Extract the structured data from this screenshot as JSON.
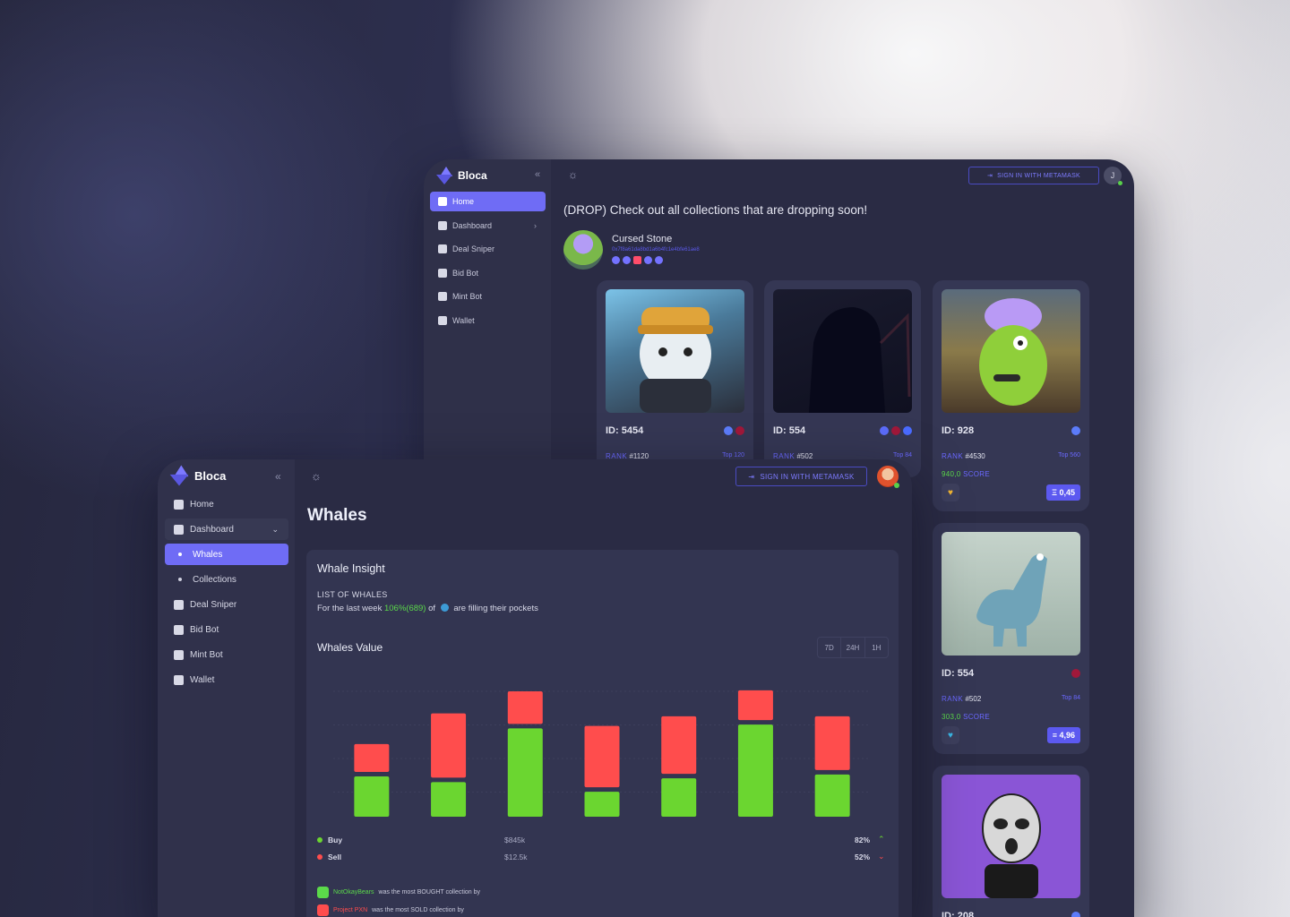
{
  "back_window": {
    "brand": "Bloca",
    "nav": [
      {
        "label": "Home",
        "icon": "home-icon",
        "active": true
      },
      {
        "label": "Dashboard",
        "icon": "chart-icon",
        "chevron": "›"
      },
      {
        "label": "Deal Sniper",
        "icon": "dollar-icon"
      },
      {
        "label": "Bid Bot",
        "icon": "bot-icon"
      },
      {
        "label": "Mint Bot",
        "icon": "bot-icon"
      },
      {
        "label": "Wallet",
        "icon": "wallet-icon"
      }
    ],
    "signin_label": "SIGN IN WITH METAMASK",
    "avatar_initial": "J",
    "heading": "(DROP) Check out all collections that are dropping soon!",
    "collection": {
      "name": "Cursed Stone",
      "address": "0x7f8a61da8bd1a6b4fc1e4bfe61ae8"
    },
    "cards": [
      {
        "id": "ID: 5454",
        "rank_label": "RANK",
        "rank": "#1120",
        "top": "Top 120"
      },
      {
        "id": "ID: 554",
        "rank_label": "RANK",
        "rank": "#502",
        "top": "Top 84"
      },
      {
        "id": "ID: 928",
        "rank_label": "RANK",
        "rank": "#4530",
        "top": "Top 560",
        "score": "940,0",
        "score_label": "SCORE",
        "price": "0,45"
      },
      {
        "id": "ID: 554",
        "rank_label": "RANK",
        "rank": "#502",
        "top": "Top 84",
        "score": "303,0",
        "score_label": "SCORE",
        "price": "4,96"
      },
      {
        "id": "ID: 208"
      }
    ]
  },
  "front_window": {
    "brand": "Bloca",
    "nav": {
      "home": "Home",
      "dashboard": "Dashboard",
      "whales": "Whales",
      "collections": "Collections",
      "deal_sniper": "Deal Sniper",
      "bid_bot": "Bid Bot",
      "mint_bot": "Mint Bot",
      "wallet": "Wallet"
    },
    "signin_label": "SIGN IN WITH METAMASK",
    "page_title": "Whales",
    "panel": {
      "title": "Whale Insight",
      "subtitle": "LIST OF WHALES",
      "line_prefix": "For the last week",
      "line_value": "106%(689)",
      "line_of": "of",
      "line_suffix": "are filling their pockets",
      "chart_title": "Whales Value",
      "ranges": [
        "7D",
        "24H",
        "1H"
      ]
    },
    "legend": [
      {
        "name": "Buy",
        "value": "$845k",
        "pct": "82%",
        "arrow": "⌃",
        "color": "#6bd630"
      },
      {
        "name": "Sell",
        "value": "$12.5k",
        "pct": "52%",
        "arrow": "⌄",
        "color": "#ff4d4d"
      }
    ],
    "notes": [
      {
        "name": "NotOkayBears",
        "text": "was the most BOUGHT collection by"
      },
      {
        "name": "Project PXN",
        "text": "was the most SOLD collection by"
      }
    ]
  },
  "chart_data": {
    "type": "bar",
    "stacked": true,
    "categories": [
      "",
      "",
      "",
      "",
      "",
      "",
      ""
    ],
    "series": [
      {
        "name": "Buy",
        "color": "#6bd630",
        "values": [
          42,
          36,
          92,
          26,
          40,
          96,
          44
        ]
      },
      {
        "name": "Sell",
        "color": "#ff4d4d",
        "values": [
          29,
          67,
          34,
          64,
          60,
          31,
          56
        ]
      }
    ],
    "ylim": [
      0,
      140
    ],
    "grid": true
  }
}
